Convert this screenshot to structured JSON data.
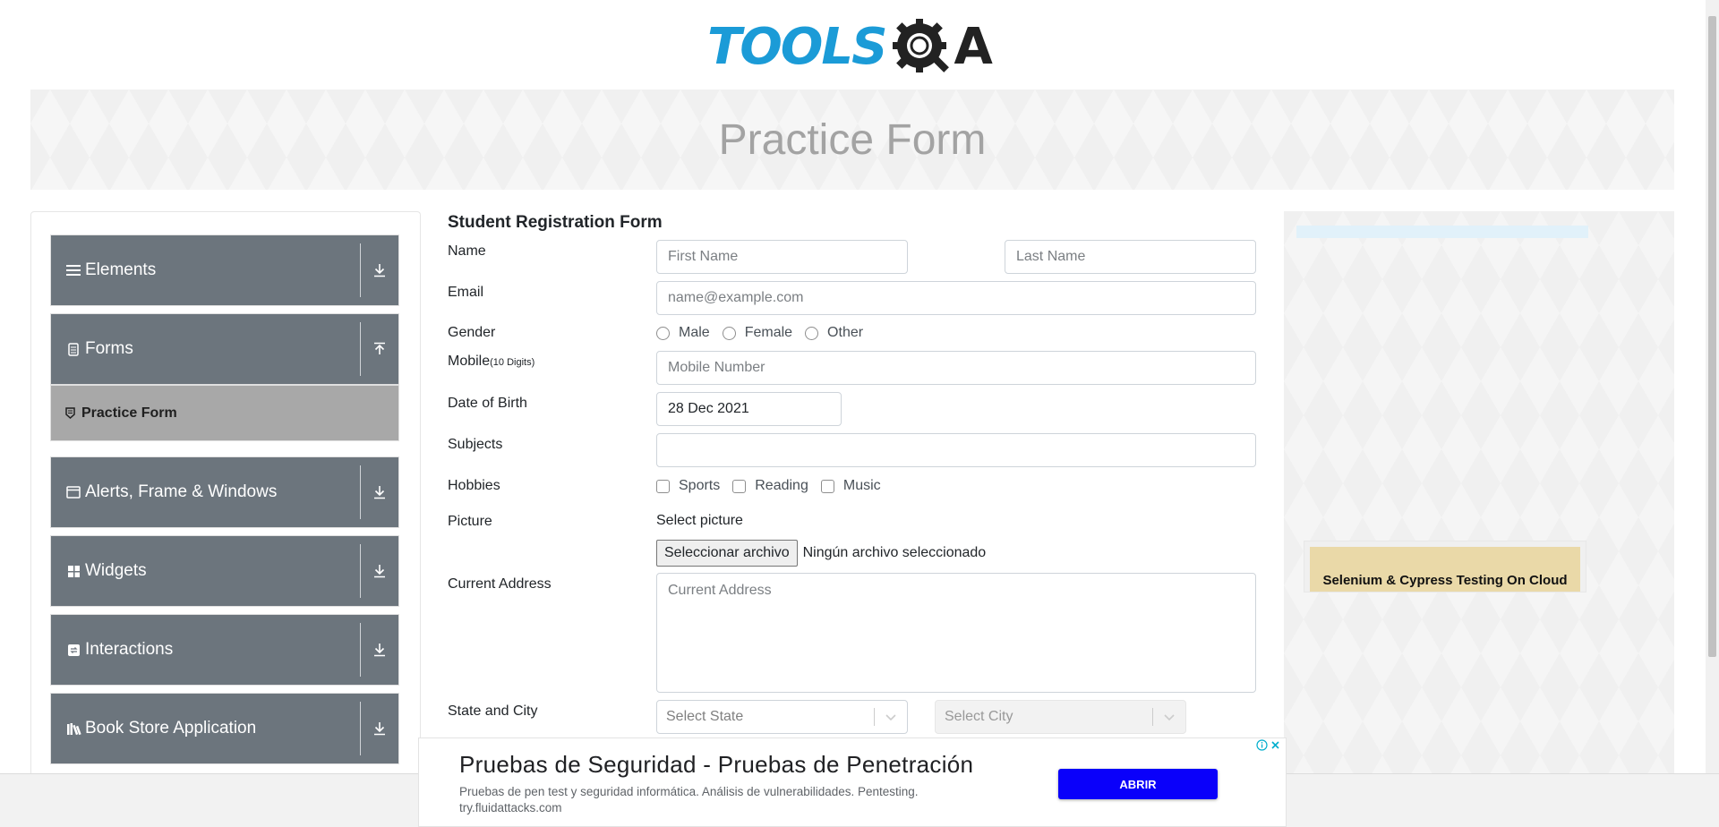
{
  "header": {
    "logo_text": "TOOLS",
    "logo_suffix": "A",
    "banner_title": "Practice Form"
  },
  "sidebar": {
    "groups": [
      {
        "label": "Elements",
        "icon": "hamburger-icon",
        "arrow": "download-icon"
      },
      {
        "label": "Forms",
        "icon": "document-icon",
        "arrow": "upload-icon"
      },
      {
        "label": "Alerts, Frame & Windows",
        "icon": "window-icon",
        "arrow": "download-icon"
      },
      {
        "label": "Widgets",
        "icon": "grid-icon",
        "arrow": "download-icon"
      },
      {
        "label": "Interactions",
        "icon": "interaction-icon",
        "arrow": "download-icon"
      },
      {
        "label": "Book Store Application",
        "icon": "books-icon",
        "arrow": "download-icon"
      }
    ],
    "active_item": {
      "label": "Practice Form",
      "icon": "shield-icon"
    }
  },
  "form": {
    "title": "Student Registration Form",
    "labels": {
      "name": "Name",
      "email": "Email",
      "gender": "Gender",
      "mobile": "Mobile",
      "mobile_hint": "(10 Digits)",
      "dob": "Date of Birth",
      "subjects": "Subjects",
      "hobbies": "Hobbies",
      "picture": "Picture",
      "address": "Current Address",
      "state_city": "State and City"
    },
    "placeholders": {
      "first_name": "First Name",
      "last_name": "Last Name",
      "email": "name@example.com",
      "mobile": "Mobile Number",
      "address": "Current Address"
    },
    "values": {
      "first_name": "",
      "last_name": "",
      "email": "",
      "mobile": "",
      "dob": "28 Dec 2021",
      "subjects": "",
      "address": ""
    },
    "gender_options": [
      "Male",
      "Female",
      "Other"
    ],
    "hobby_options": [
      "Sports",
      "Reading",
      "Music"
    ],
    "picture": {
      "select_text": "Select picture",
      "button_label": "Seleccionar archivo",
      "status": "Ningún archivo seleccionado"
    },
    "state_placeholder": "Select State",
    "city_placeholder": "Select City"
  },
  "right_ad": {
    "text": "Selenium & Cypress Testing On Cloud"
  },
  "bottom_ad": {
    "title": "Pruebas de Seguridad - Pruebas de Penetración",
    "description": "Pruebas de pen test y seguridad informática. Análisis de vulnerabilidades. Pentesting.",
    "url": "try.fluidattacks.com",
    "button": "ABRIR",
    "button_color": "#0a00fa"
  },
  "colors": {
    "sidebar_group": "#6c757d",
    "sidebar_active": "#a8a8a8",
    "logo_blue": "#1b9bd7"
  }
}
